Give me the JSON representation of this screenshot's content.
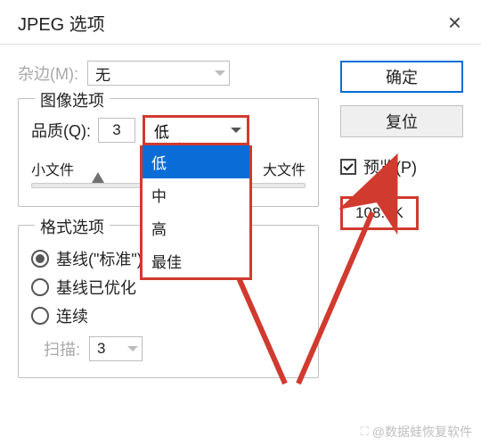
{
  "titlebar": {
    "title": "JPEG 选项"
  },
  "matte": {
    "label": "杂边(M):",
    "value": "无"
  },
  "image_options": {
    "legend": "图像选项",
    "quality_label": "品质(Q):",
    "quality_value": "3",
    "quality_preset": "低",
    "preset_options": [
      "低",
      "中",
      "高",
      "最佳"
    ],
    "small_file": "小文件",
    "large_file": "大文件"
  },
  "format_options": {
    "legend": "格式选项",
    "radios": {
      "baseline_standard": "基线(\"标准\")",
      "baseline_optimized": "基线已优化",
      "progressive": "连续"
    },
    "scans_label": "扫描:",
    "scans_value": "3"
  },
  "right": {
    "ok": "确定",
    "reset": "复位",
    "preview": "预览(P)",
    "file_size": "108.1K"
  },
  "watermark": "@数据蛙恢复软件",
  "colors": {
    "accent_red": "#d13a2f",
    "accent_blue": "#0a6cd6"
  }
}
